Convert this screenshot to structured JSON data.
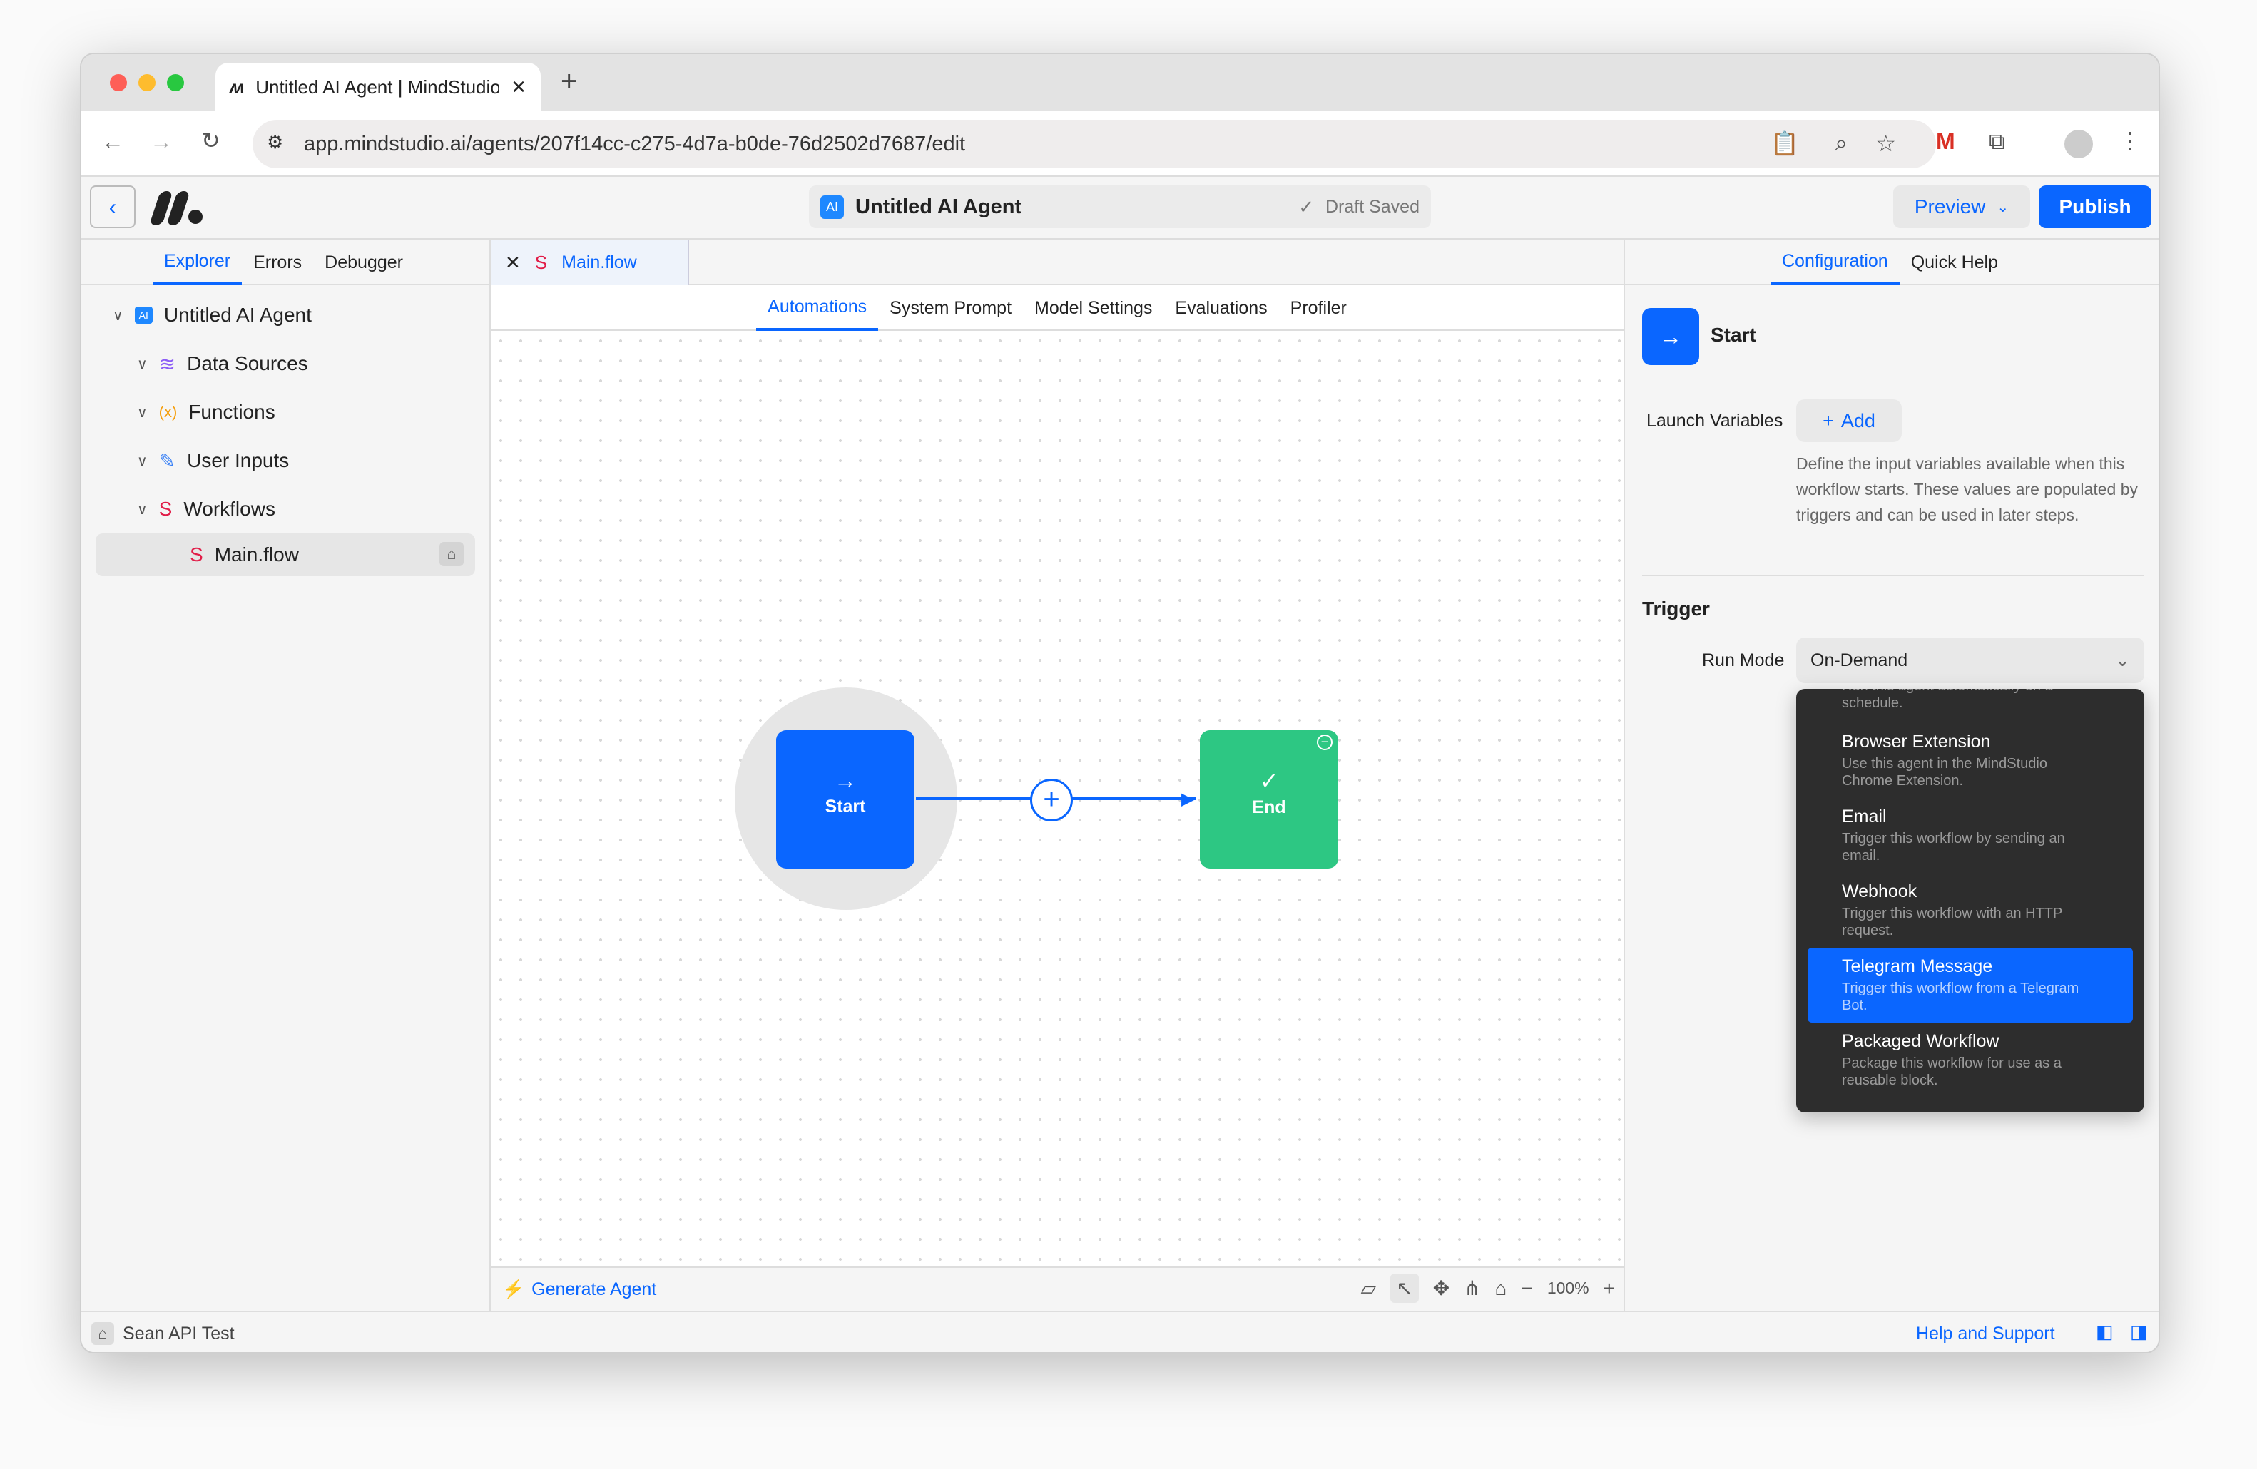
{
  "browser": {
    "tab_title": "Untitled AI Agent | MindStudio",
    "url": "app.mindstudio.ai/agents/207f14cc-c275-4d7a-b0de-76d2502d7687/edit"
  },
  "header": {
    "agent_name": "Untitled AI Agent",
    "agent_badge": "AI",
    "draft_status": "Draft Saved",
    "preview_label": "Preview",
    "publish_label": "Publish"
  },
  "left": {
    "tabs": [
      "Explorer",
      "Errors",
      "Debugger"
    ],
    "root": "Untitled AI Agent",
    "items": [
      "Data Sources",
      "Functions",
      "User Inputs",
      "Workflows"
    ],
    "file": "Main.flow"
  },
  "center": {
    "file_tab": "Main.flow",
    "subtabs": [
      "Automations",
      "System Prompt",
      "Model Settings",
      "Evaluations",
      "Profiler"
    ],
    "start_label": "Start",
    "end_label": "End",
    "generate_label": "Generate Agent",
    "zoom": "100%"
  },
  "right": {
    "tabs": [
      "Configuration",
      "Quick Help"
    ],
    "block_title": "Start",
    "launch_vars_label": "Launch Variables",
    "add_label": "Add",
    "launch_desc": "Define the input variables available when this workflow starts. These values are populated by triggers and can be used in later steps.",
    "trigger_heading": "Trigger",
    "run_mode_label": "Run Mode",
    "run_mode_value": "On-Demand",
    "options": [
      {
        "title": "",
        "desc": "Run this agent automatically on a schedule."
      },
      {
        "title": "Browser Extension",
        "desc": "Use this agent in the MindStudio Chrome Extension."
      },
      {
        "title": "Email",
        "desc": "Trigger this workflow by sending an email."
      },
      {
        "title": "Webhook",
        "desc": "Trigger this workflow with an HTTP request."
      },
      {
        "title": "Telegram Message",
        "desc": "Trigger this workflow from a Telegram Bot."
      },
      {
        "title": "Packaged Workflow",
        "desc": "Package this workflow for use as a reusable block."
      }
    ]
  },
  "status": {
    "workspace": "Sean API Test",
    "help": "Help and Support"
  },
  "colors": {
    "accent": "#0a66ff",
    "end": "#2dc783",
    "dropdown": "#2d2d2d"
  }
}
